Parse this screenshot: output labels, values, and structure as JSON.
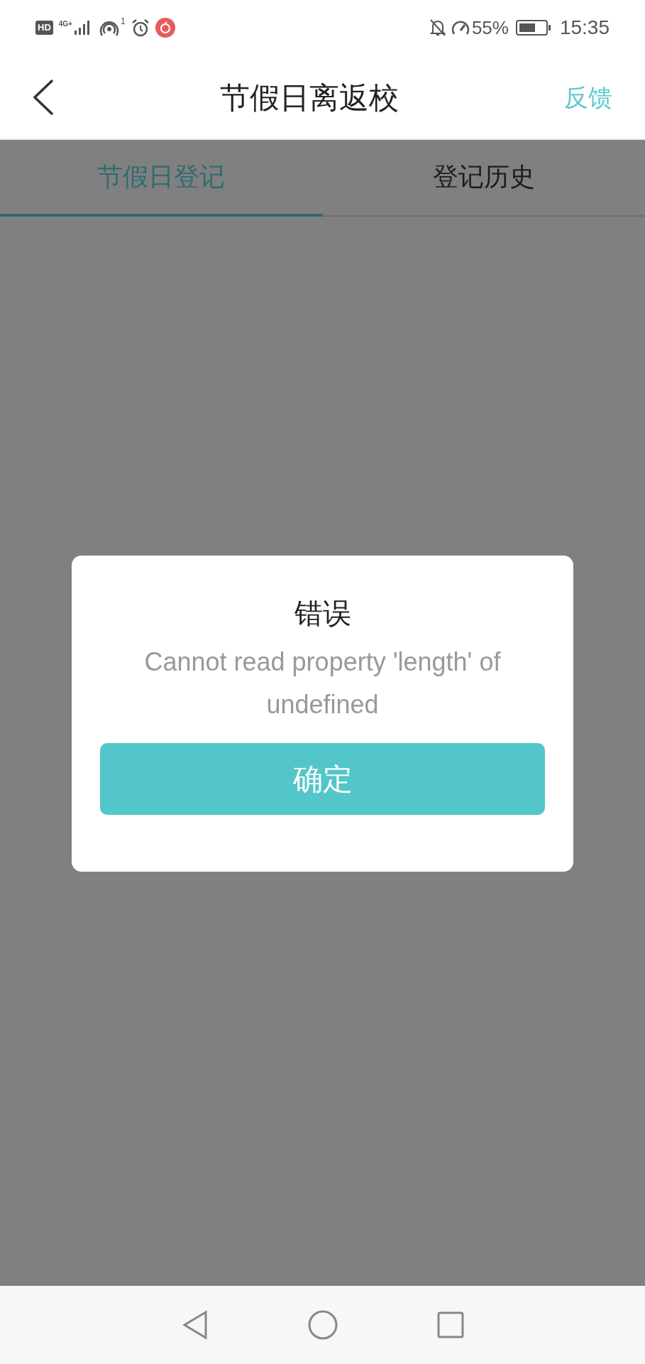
{
  "status_bar": {
    "hd": "HD",
    "network": "4G+",
    "hotspot_count": "1",
    "battery": "55%",
    "time": "15:35"
  },
  "header": {
    "title": "节假日离返校",
    "action": "反馈"
  },
  "tabs": [
    {
      "label": "节假日登记",
      "selected": true
    },
    {
      "label": "登记历史",
      "selected": false
    }
  ],
  "dialog": {
    "title": "错误",
    "message": "Cannot read property 'length' of undefined",
    "button": "确定"
  }
}
